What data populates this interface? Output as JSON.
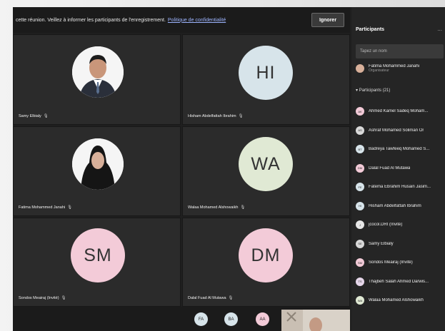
{
  "banner": {
    "text": "cette réunion. Veillez à informer les participants de l'enregistrement.",
    "link": "Politique de confidentialité",
    "ignore_label": "Ignorer"
  },
  "tiles": [
    {
      "name": "Samy Elbialy",
      "type": "photo"
    },
    {
      "name": "Hisham Abdelfattah Ibrahim",
      "type": "initials",
      "initials": "HI",
      "color": "#d7e4ea"
    },
    {
      "name": "Fatima Mohammed Janahi",
      "type": "photo"
    },
    {
      "name": "Walaa Mohamed Alshowaikh",
      "type": "initials",
      "initials": "WA",
      "color": "#e0e9d4"
    },
    {
      "name": "Sondos Meairaj (Invité)",
      "type": "initials",
      "initials": "SM",
      "color": "#f3cbd8"
    },
    {
      "name": "Dalal Fuad Al Mutawa",
      "type": "initials",
      "initials": "DM",
      "color": "#f3cbd8"
    }
  ],
  "bottom": {
    "avatars": [
      {
        "initials": "FA",
        "color": "#d7e4ea"
      },
      {
        "initials": "BA",
        "color": "#d7e4ea"
      },
      {
        "initials": "AA",
        "color": "#f3cbd8"
      }
    ]
  },
  "panel": {
    "title": "Participants",
    "more": "...",
    "search_placeholder": "Tapez un nom",
    "organizer": {
      "name": "Fatima Mohammed Janahi",
      "role": "Organisateur"
    },
    "section_label": "Participants (21)",
    "participants": [
      {
        "name": "Ahmed Kamel Sadeq Moham...",
        "initials": "AK",
        "color": "#f3cbd8"
      },
      {
        "name": "Ashraf Mohamed Soliman Or",
        "initials": "AS",
        "color": "#d9d9d9"
      },
      {
        "name": "Badreya Tawfeeq Mohamed S...",
        "initials": "BT",
        "color": "#d7e4ea"
      },
      {
        "name": "Dalal Fuad Al Mutawa",
        "initials": "DM",
        "color": "#f3cbd8"
      },
      {
        "name": "Fatema Ebrahim Husain Jasim...",
        "initials": "FE",
        "color": "#d7e4ea"
      },
      {
        "name": "Hisham Abdelfattah Ibrahim",
        "initials": "HI",
        "color": "#d7e4ea"
      },
      {
        "name": "jcocol.DRI (Invité)",
        "initials": "J",
        "color": "#e6e6e6"
      },
      {
        "name": "Samy Elbialy",
        "initials": "SE",
        "color": "#d9d9d9"
      },
      {
        "name": "Sondos Meairaj (Invité)",
        "initials": "SM",
        "color": "#f3cbd8"
      },
      {
        "name": "Thajbeh Salah Ahmed Darwis...",
        "initials": "TS",
        "color": "#e6d7ea"
      },
      {
        "name": "Walaa Mohamed Alshowaikh",
        "initials": "WA",
        "color": "#e0e9d4"
      }
    ]
  }
}
